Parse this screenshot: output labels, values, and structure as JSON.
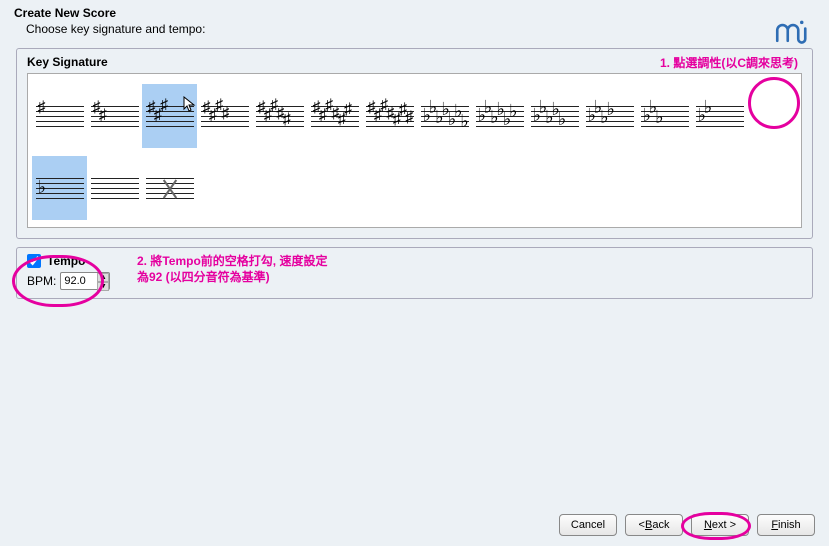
{
  "header": {
    "title": "Create New Score",
    "subtitle": "Choose key signature and tempo:"
  },
  "keysig": {
    "title": "Key Signature",
    "items": [
      {
        "type": "sharp",
        "count": 1,
        "selected": false
      },
      {
        "type": "sharp",
        "count": 2,
        "selected": false
      },
      {
        "type": "sharp",
        "count": 3,
        "selected": true
      },
      {
        "type": "sharp",
        "count": 4,
        "selected": false
      },
      {
        "type": "sharp",
        "count": 5,
        "selected": false
      },
      {
        "type": "sharp",
        "count": 6,
        "selected": false
      },
      {
        "type": "sharp",
        "count": 7,
        "selected": false
      },
      {
        "type": "flat",
        "count": 7,
        "selected": false
      },
      {
        "type": "flat",
        "count": 6,
        "selected": false
      },
      {
        "type": "flat",
        "count": 5,
        "selected": false
      },
      {
        "type": "flat",
        "count": 4,
        "selected": false
      },
      {
        "type": "flat",
        "count": 3,
        "selected": false
      },
      {
        "type": "flat",
        "count": 2,
        "selected": false
      },
      {
        "type": "flat",
        "count": 1,
        "selected": true
      },
      {
        "type": "none",
        "count": 0,
        "selected": false
      },
      {
        "type": "natural",
        "count": 0,
        "selected": false
      }
    ]
  },
  "tempo": {
    "checkbox_label": "Tempo",
    "checked": true,
    "bpm_label": "BPM:",
    "bpm_value": "92.0"
  },
  "annotations": {
    "a1": "1. 點選調性(以C調來思考)",
    "a2_line1": "2. 將Tempo前的空格打勾, 速度設定",
    "a2_line2": "為92 (以四分音符為基準)"
  },
  "footer": {
    "cancel": "Cancel",
    "back": "< Back",
    "next": "Next >",
    "finish": "Finish"
  },
  "logo_color": "#2e6db4"
}
